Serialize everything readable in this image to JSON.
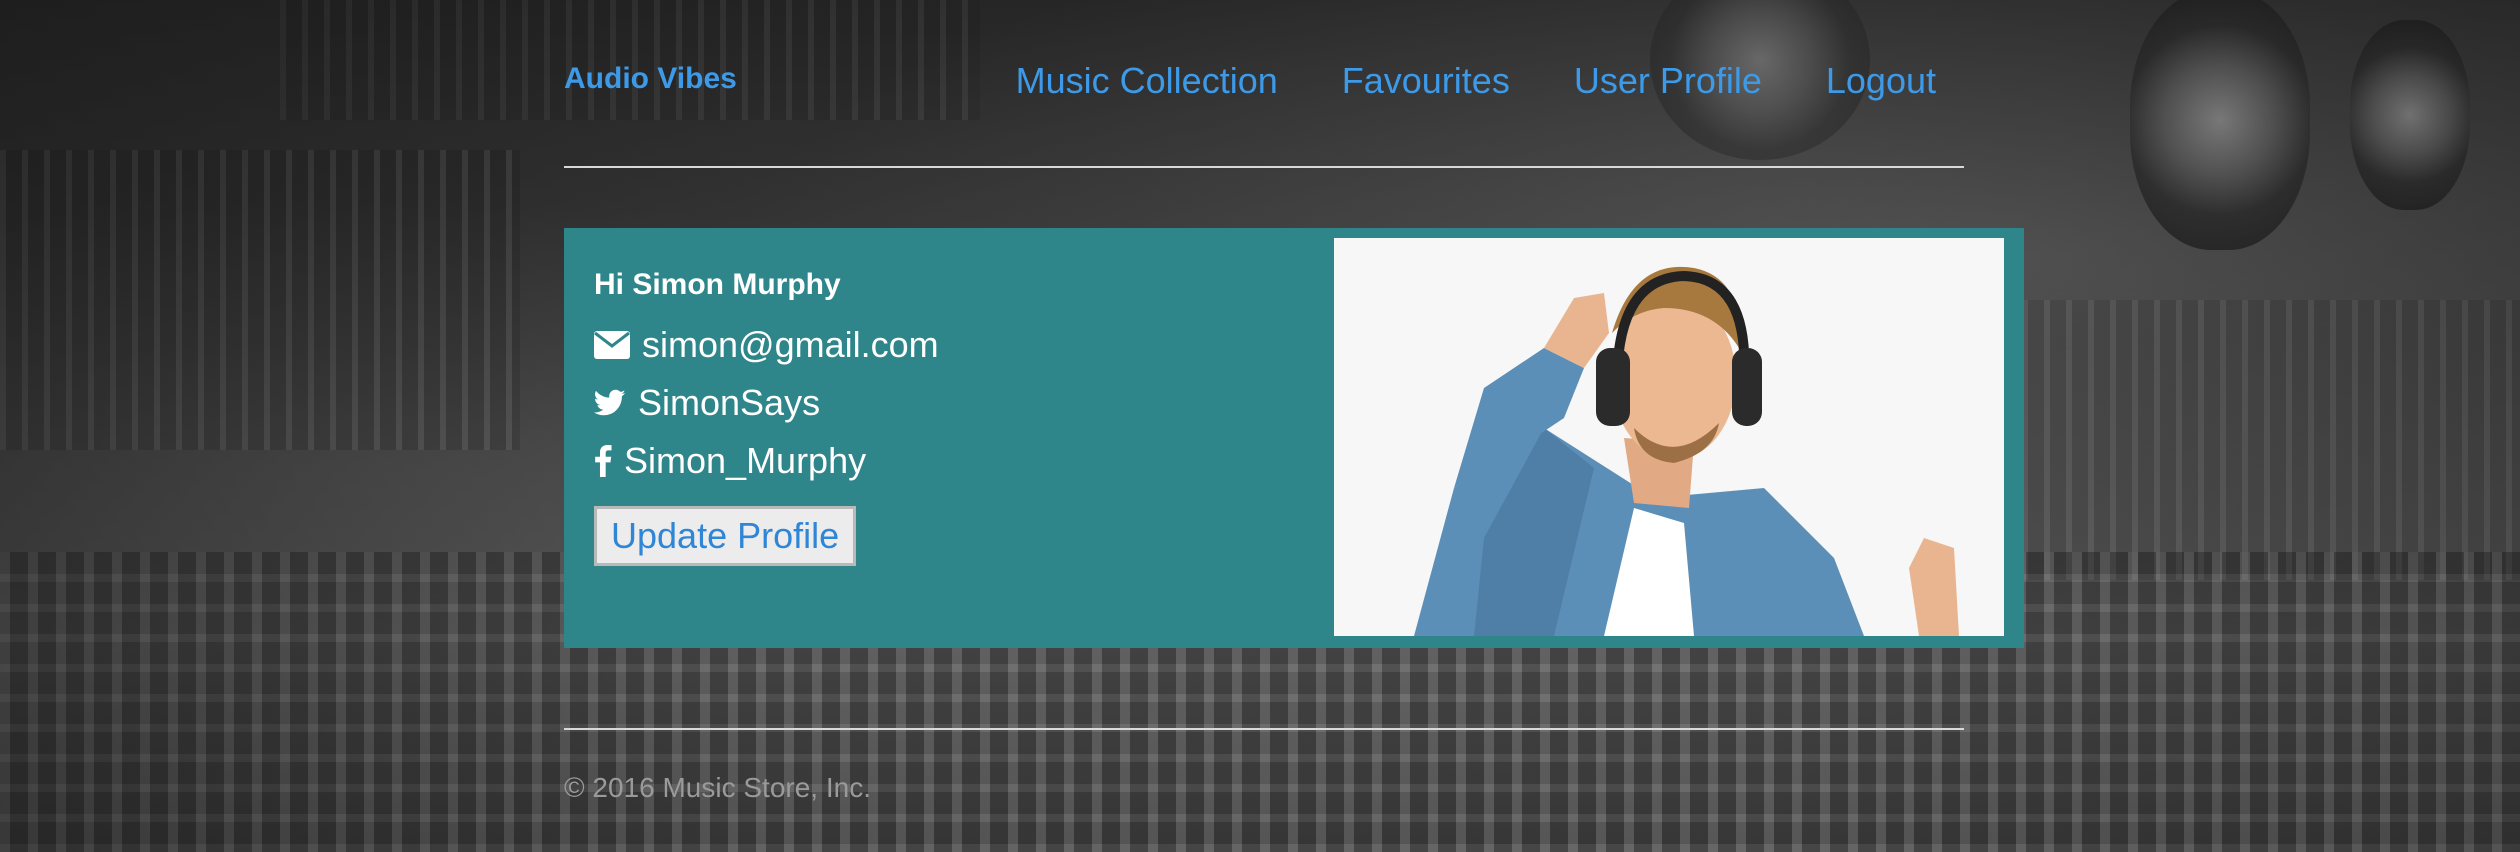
{
  "brand": "Audio Vibes",
  "nav": {
    "items": [
      {
        "label": "Music Collection"
      },
      {
        "label": "Favourites"
      },
      {
        "label": "User Profile"
      },
      {
        "label": "Logout"
      }
    ]
  },
  "profile": {
    "greeting": "Hi Simon Murphy",
    "email": "simon@gmail.com",
    "twitter": "SimonSays",
    "facebook": "Simon_Murphy",
    "update_button": "Update Profile",
    "email_icon": "envelope-icon",
    "twitter_icon": "twitter-icon",
    "facebook_icon": "facebook-icon"
  },
  "footer": {
    "copyright": "© 2016 Music Store, Inc."
  },
  "colors": {
    "accent": "#3d9ae8",
    "card": "#2f868a",
    "footer_text": "#9a9a9a"
  }
}
